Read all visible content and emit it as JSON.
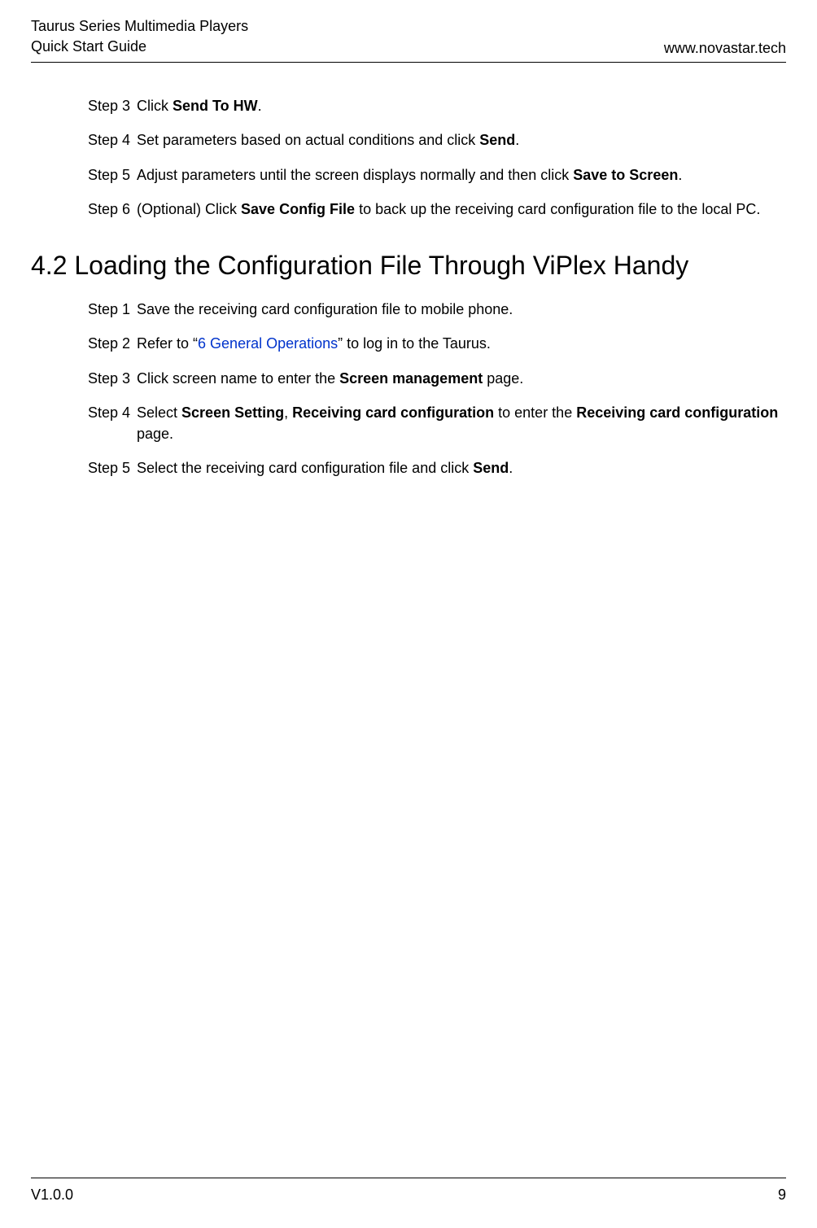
{
  "header": {
    "title_line1": "Taurus Series Multimedia Players",
    "title_line2": "Quick Start Guide",
    "url": "www.novastar.tech"
  },
  "section_a": {
    "steps": [
      {
        "label": "Step 3",
        "parts": [
          {
            "text": "Click ",
            "bold": false
          },
          {
            "text": "Send To HW",
            "bold": true
          },
          {
            "text": ".",
            "bold": false
          }
        ]
      },
      {
        "label": "Step 4",
        "parts": [
          {
            "text": "Set parameters based on actual conditions and click ",
            "bold": false
          },
          {
            "text": "Send",
            "bold": true
          },
          {
            "text": ".",
            "bold": false
          }
        ]
      },
      {
        "label": "Step 5",
        "parts": [
          {
            "text": "Adjust parameters until the screen displays normally and then click ",
            "bold": false
          },
          {
            "text": "Save to Screen",
            "bold": true
          },
          {
            "text": ".",
            "bold": false
          }
        ]
      },
      {
        "label": "Step 6",
        "parts": [
          {
            "text": "(Optional) Click ",
            "bold": false
          },
          {
            "text": "Save Config File",
            "bold": true
          },
          {
            "text": " to back up the receiving card configuration file to the local PC.",
            "bold": false
          }
        ]
      }
    ]
  },
  "section_b": {
    "heading": "4.2  Loading the Configuration File Through ViPlex Handy",
    "steps": [
      {
        "label": "Step 1",
        "parts": [
          {
            "text": "Save the receiving card configuration file to mobile phone.",
            "bold": false
          }
        ]
      },
      {
        "label": "Step 2",
        "parts": [
          {
            "text": "Refer to “",
            "bold": false
          },
          {
            "text": "6 General Operations",
            "bold": false,
            "link": true
          },
          {
            "text": "” to log in to the Taurus.",
            "bold": false
          }
        ]
      },
      {
        "label": "Step 3",
        "parts": [
          {
            "text": "Click screen name to enter the ",
            "bold": false
          },
          {
            "text": "Screen management",
            "bold": true
          },
          {
            "text": " page.",
            "bold": false
          }
        ]
      },
      {
        "label": "Step 4",
        "parts": [
          {
            "text": "Select ",
            "bold": false
          },
          {
            "text": "Screen Setting",
            "bold": true
          },
          {
            "text": ", ",
            "bold": false
          },
          {
            "text": "Receiving card configuration",
            "bold": true
          },
          {
            "text": " to enter the ",
            "bold": false
          },
          {
            "text": "Receiving card configuration",
            "bold": true
          },
          {
            "text": " page.",
            "bold": false
          }
        ]
      },
      {
        "label": "Step 5",
        "parts": [
          {
            "text": "Select the receiving card configuration file and click ",
            "bold": false
          },
          {
            "text": "Send",
            "bold": true
          },
          {
            "text": ".",
            "bold": false
          }
        ]
      }
    ]
  },
  "footer": {
    "version": "V1.0.0",
    "page": "9"
  }
}
